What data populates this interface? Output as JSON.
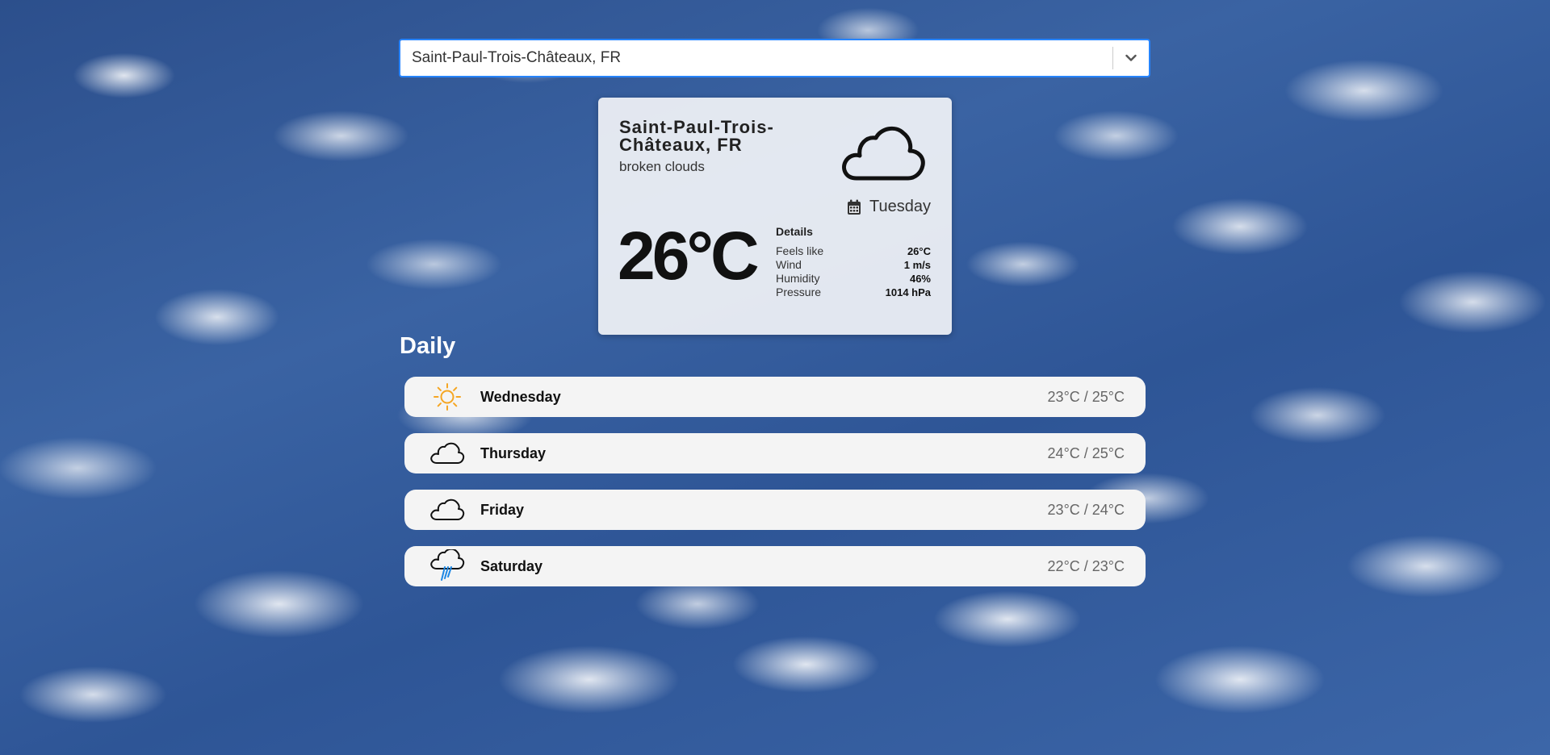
{
  "search": {
    "value": "Saint-Paul-Trois-Châteaux, FR",
    "dropdown_icon": "chevron-down-icon"
  },
  "current": {
    "city": "Saint-Paul-Trois-Châteaux, FR",
    "description": "broken clouds",
    "icon": "cloud-icon",
    "day_icon": "calendar-icon",
    "day": "Tuesday",
    "temperature": "26°C",
    "details": {
      "title": "Details",
      "rows": [
        {
          "label": "Feels like",
          "value": "26°C"
        },
        {
          "label": "Wind",
          "value": "1 m/s"
        },
        {
          "label": "Humidity",
          "value": "46%"
        },
        {
          "label": "Pressure",
          "value": "1014 hPa"
        }
      ]
    }
  },
  "daily": {
    "title": "Daily",
    "items": [
      {
        "day": "Wednesday",
        "range": "23°C / 25°C",
        "icon": "sun-icon"
      },
      {
        "day": "Thursday",
        "range": "24°C / 25°C",
        "icon": "cloud-icon"
      },
      {
        "day": "Friday",
        "range": "23°C / 24°C",
        "icon": "cloud-icon"
      },
      {
        "day": "Saturday",
        "range": "22°C / 23°C",
        "icon": "rain-cloud-icon"
      }
    ]
  },
  "colors": {
    "accent": "#2684ff",
    "sun": "#f5a623",
    "rain": "#1e88e5"
  }
}
